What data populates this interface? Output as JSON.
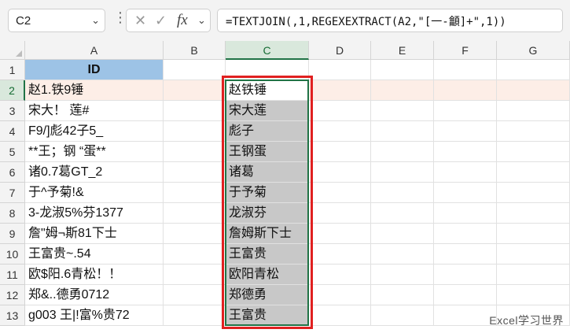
{
  "formula_bar": {
    "name_box": "C2",
    "formula": "=TEXTJOIN(,1,REGEXEXTRACT(A2,\"[一-龥]+\",1))"
  },
  "columns": [
    "A",
    "B",
    "C",
    "D",
    "E",
    "F",
    "G"
  ],
  "rows": [
    "1",
    "2",
    "3",
    "4",
    "5",
    "6",
    "7",
    "8",
    "9",
    "10",
    "11",
    "12",
    "13"
  ],
  "column_a": {
    "header": "ID",
    "values": [
      "赵1.铁9锤",
      "宋大！ 莲#",
      "F9/]彪42子5_",
      "**王；钢 “蛋**",
      "诸0.7葛GT_2",
      "于^予菊!&",
      "3-龙淑5%芬1377",
      "詹\"姆¬斯81下士",
      "王富贵~.54",
      "欧$阳.6青松！！",
      "郑&..德勇0712",
      "g003 王|!富%贵72"
    ]
  },
  "column_c": {
    "values": [
      "赵铁锤",
      "宋大莲",
      "彪子",
      "王钢蛋",
      "诸葛",
      "于予菊",
      "龙淑芬",
      "詹姆斯下士",
      "王富贵",
      "欧阳青松",
      "郑德勇",
      "王富贵"
    ]
  },
  "watermark": "Excel学习世界",
  "colors": {
    "header_fill": "#9dc3e6",
    "result_fill": "#c8c8c8",
    "active_row_fill": "#fdeee7",
    "selection": "#217346",
    "highlight_box": "#e02020"
  }
}
